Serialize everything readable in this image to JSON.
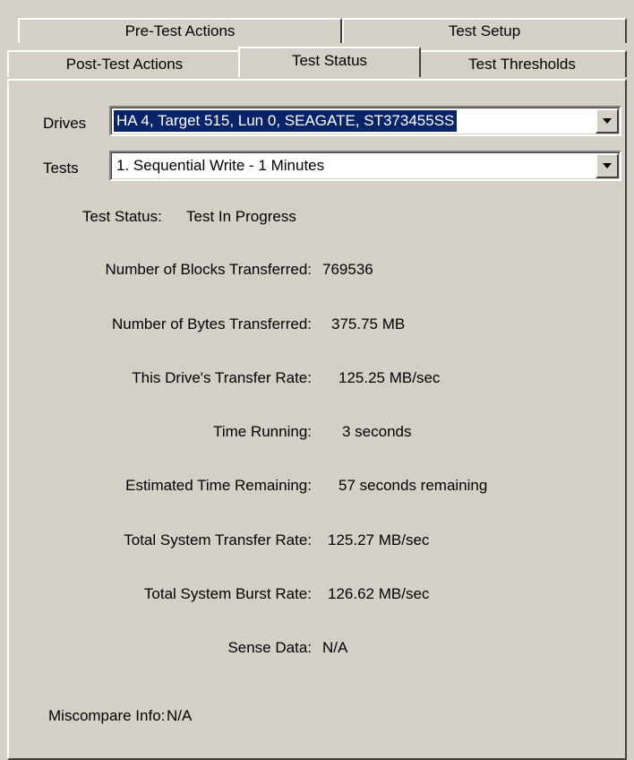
{
  "tabs": {
    "back_row": [
      {
        "label": "Pre-Test Actions"
      },
      {
        "label": "Test Setup"
      }
    ],
    "front_row": [
      {
        "label": "Post-Test Actions"
      },
      {
        "label": "Test Status",
        "active": true
      },
      {
        "label": "Test Thresholds"
      }
    ]
  },
  "drives": {
    "label": "Drives",
    "selected": "HA 4, Target 515, Lun 0, SEAGATE, ST373455SS"
  },
  "tests": {
    "label": "Tests",
    "selected": "1. Sequential  Write  - 1 Minutes"
  },
  "status": {
    "label": "Test Status:",
    "value": "Test In Progress"
  },
  "stats": [
    {
      "label": "Number of Blocks Transferred:",
      "value": "769536"
    },
    {
      "label": "Number of Bytes Transferred:",
      "value": "375.75 MB"
    },
    {
      "label": "This Drive's Transfer Rate:",
      "value": "125.25 MB/sec"
    },
    {
      "label": "Time Running:",
      "value": "3 seconds"
    },
    {
      "label": "Estimated Time Remaining:",
      "value": "57 seconds remaining"
    },
    {
      "label": "Total System Transfer Rate:",
      "value": "125.27 MB/sec"
    },
    {
      "label": "Total System Burst Rate:",
      "value": "126.62 MB/sec"
    },
    {
      "label": "Sense Data:",
      "value": "N/A"
    }
  ],
  "miscompare": {
    "label": "Miscompare Info:",
    "value": "N/A"
  },
  "icons": {
    "dropdown": "chevron-down-icon"
  },
  "colors": {
    "background": "#d4d0c8",
    "selection": "#0a246a"
  }
}
